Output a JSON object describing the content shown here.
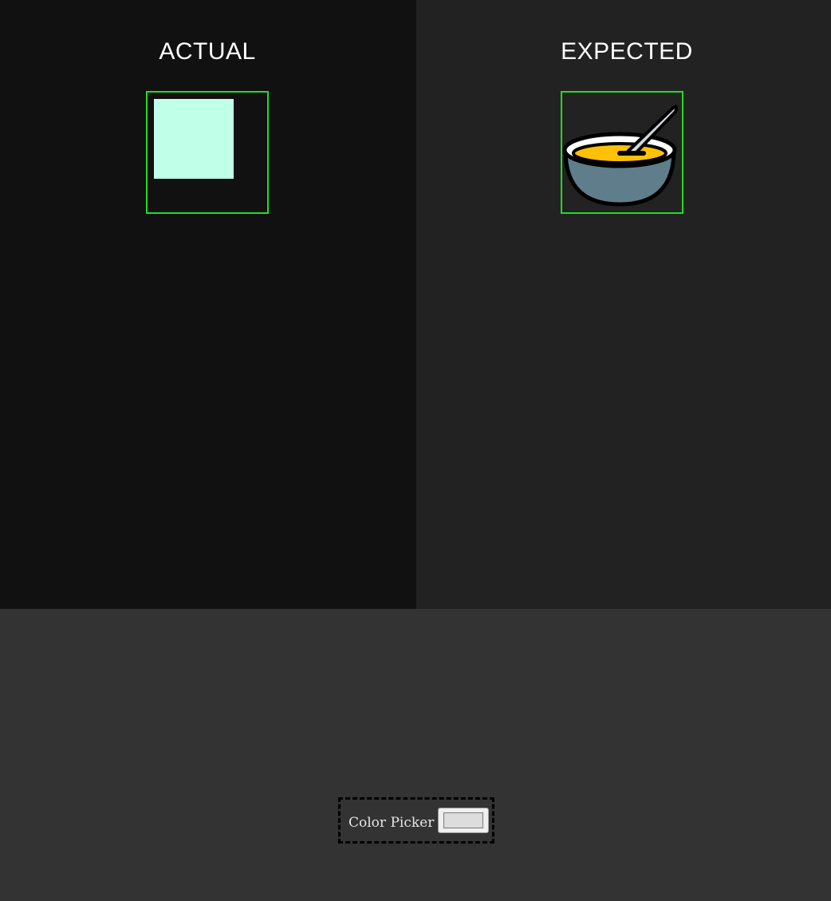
{
  "actual": {
    "title": "ACTUAL",
    "square_color": "#c0ffe8"
  },
  "expected": {
    "title": "EXPECTED",
    "icon": "soup-bowl-icon"
  },
  "picker": {
    "label": "Color Picker",
    "value": "#dddddd"
  },
  "colors": {
    "frame": "#22dd22",
    "actual_bg": "#111111",
    "expected_bg": "#222222",
    "page_bg": "#333333"
  }
}
